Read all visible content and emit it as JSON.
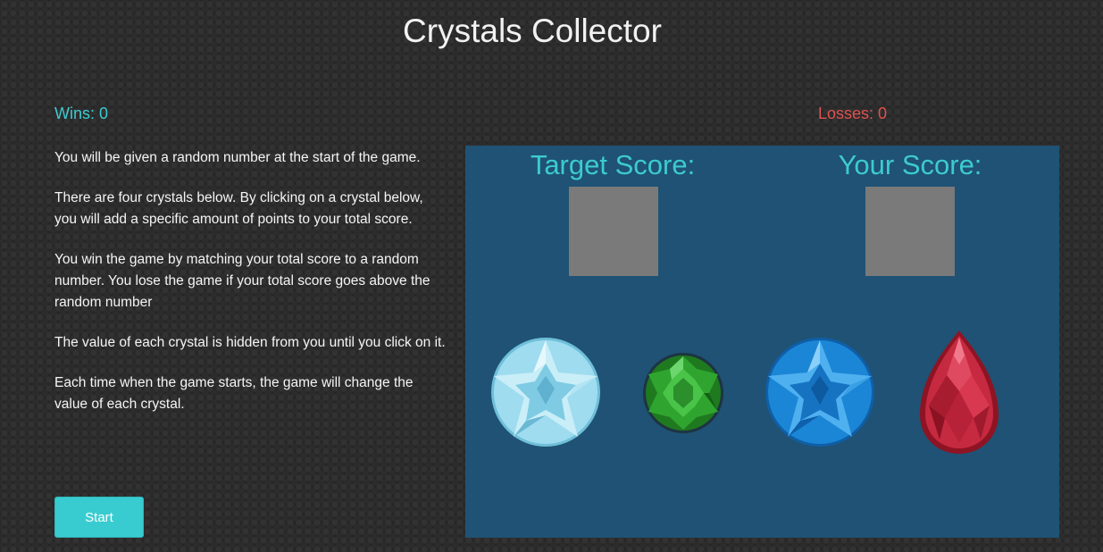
{
  "title": "Crystals Collector",
  "stats": {
    "wins": "Wins: 0",
    "losses": "Losses: 0"
  },
  "instructions": [
    "You will be given a random number at the start of the game.",
    "There are four crystals below. By clicking on a crystal below, you will add a specific amount of points to your total score.",
    "You win the game by matching your total score to a random number. You lose the game if your total score goes above the random number",
    "The value of each crystal is hidden from you until you click on it.",
    "Each time when the game starts, the game will change the value of each crystal."
  ],
  "start_button": "Start",
  "scoreboard": {
    "target_label": "Target Score:",
    "your_label": "Your Score:",
    "target_value": "",
    "your_value": ""
  },
  "crystals": [
    {
      "icon": "light-blue-crystal-icon",
      "color": "#8fd3ea"
    },
    {
      "icon": "green-crystal-icon",
      "color": "#2f9a2f"
    },
    {
      "icon": "blue-crystal-icon",
      "color": "#1a7fd0"
    },
    {
      "icon": "red-crystal-icon",
      "color": "#c0283c"
    }
  ],
  "colors": {
    "accent": "#38ccd1",
    "losses": "#e0524f",
    "panel": "#1f5274",
    "score_box": "#7a7a7a",
    "background": "#262626"
  }
}
